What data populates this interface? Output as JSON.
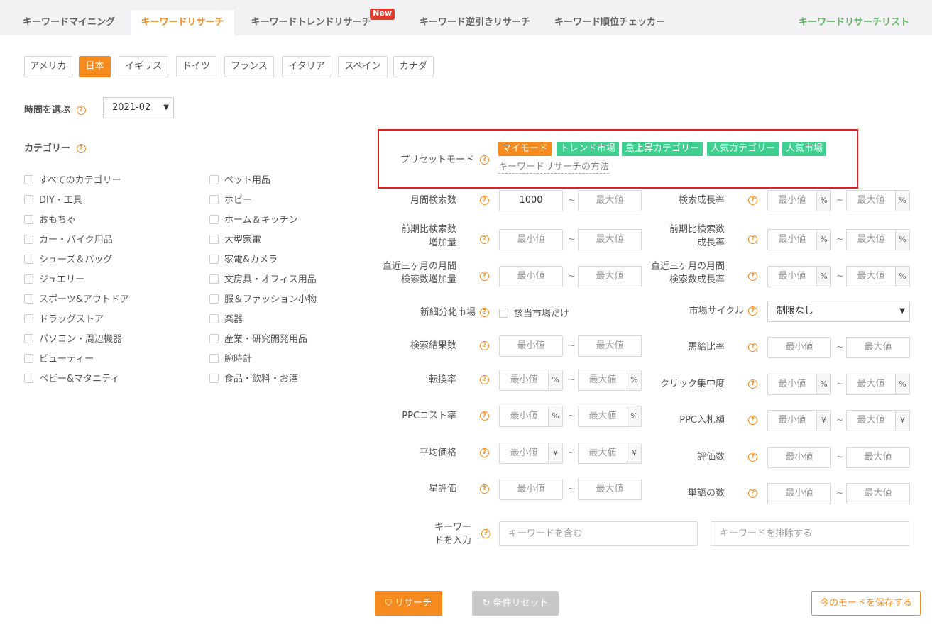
{
  "tabs": [
    {
      "label": "キーワードマイニング"
    },
    {
      "label": "キーワードリサーチ"
    },
    {
      "label": "キーワードトレンドリサーチ",
      "badge": "New"
    },
    {
      "label": "キーワード逆引きリサーチ"
    },
    {
      "label": "キーワード順位チェッカー"
    }
  ],
  "list_link": "キーワードリサーチリスト",
  "countries": [
    "アメリカ",
    "日本",
    "イギリス",
    "ドイツ",
    "フランス",
    "イタリア",
    "スペイン",
    "カナダ"
  ],
  "active_country": "日本",
  "time": {
    "label": "時間を選ぶ",
    "value": "2021-02"
  },
  "category": {
    "label": "カテゴリー",
    "left": [
      "すべてのカテゴリー",
      "DIY・工具",
      "おもちゃ",
      "カー・バイク用品",
      "シューズ＆バッグ",
      "ジュエリー",
      "スポーツ&アウトドア",
      "ドラッグストア",
      "パソコン・周辺機器",
      "ビューティー",
      "ベビー&マタニティ"
    ],
    "right": [
      "ペット用品",
      "ホビー",
      "ホーム＆キッチン",
      "大型家電",
      "家電&カメラ",
      "文房具・オフィス用品",
      "服＆ファッション小物",
      "楽器",
      "産業・研究開発用品",
      "腕時計",
      "食品・飲料・お酒"
    ]
  },
  "preset": {
    "label": "プリセットモード",
    "tags": [
      "マイモード",
      "トレンド市場",
      "急上昇カテゴリー",
      "人気カテゴリー",
      "人気市場"
    ],
    "method_link": "キーワードリサーチの方法"
  },
  "placeholders": {
    "min": "最小値",
    "max": "最大値"
  },
  "filters": {
    "monthly_search": {
      "label": "月間検索数",
      "min_value": "1000"
    },
    "search_growth": {
      "label": "検索成長率",
      "unit": "%"
    },
    "prev_increase": {
      "label1": "前期比検索数",
      "label2": "増加量"
    },
    "prev_growth": {
      "label1": "前期比検索数",
      "label2": "成長率",
      "unit": "%"
    },
    "recent3_increase": {
      "label1": "直近三ヶ月の月間",
      "label2": "検索数増加量"
    },
    "recent3_growth": {
      "label1": "直近三ヶ月の月間",
      "label2": "検索数成長率",
      "unit": "%"
    },
    "niche": {
      "label": "新細分化市場",
      "checkbox": "該当市場だけ"
    },
    "market_cycle": {
      "label": "市場サイクル",
      "value": "制限なし"
    },
    "result_count": {
      "label": "検索結果数"
    },
    "supply_demand": {
      "label": "需給比率"
    },
    "conversion": {
      "label": "転換率",
      "unit": "%"
    },
    "click_concentration": {
      "label": "クリック集中度",
      "unit": "%"
    },
    "ppc_cost": {
      "label": "PPCコスト率",
      "unit": "%"
    },
    "ppc_bid": {
      "label": "PPC入札額",
      "unit": "¥"
    },
    "avg_price": {
      "label": "平均価格",
      "unit": "¥"
    },
    "review_count": {
      "label": "評価数"
    },
    "star_rating": {
      "label": "星評価"
    },
    "word_count": {
      "label": "単語の数"
    },
    "keyword": {
      "label1": "キーワー",
      "label2": "ドを入力",
      "include_ph": "キーワードを含む",
      "exclude_ph": "キーワードを排除する"
    }
  },
  "tilde": "~",
  "help_glyph": "?",
  "buttons": {
    "research": "リサーチ",
    "reset": "条件リセット",
    "save": "今のモードを保存する"
  },
  "colors": {
    "accent": "#f58a1f",
    "green": "#3fcf8f",
    "highlight_border": "#e02020",
    "list_link": "#5cb85c",
    "new_badge": "#e23b2b"
  }
}
